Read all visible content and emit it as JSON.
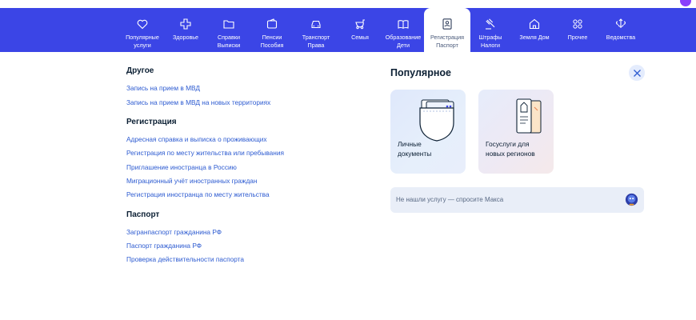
{
  "nav": [
    {
      "label": "Популярные\nуслуги",
      "icon": "heart-icon"
    },
    {
      "label": "Здоровье",
      "icon": "medical-cross-icon"
    },
    {
      "label": "Справки\nВыписки",
      "icon": "folder-icon"
    },
    {
      "label": "Пенсии\nПособия",
      "icon": "wallet-icon"
    },
    {
      "label": "Транспорт\nПрава",
      "icon": "car-icon"
    },
    {
      "label": "Семья",
      "icon": "stroller-icon"
    },
    {
      "label": "Образование\nДети",
      "icon": "book-icon"
    },
    {
      "label": "Регистрация\nПаспорт",
      "icon": "passport-icon",
      "active": true
    },
    {
      "label": "Штрафы\nНалоги",
      "icon": "gavel-icon"
    },
    {
      "label": "Земля Дом",
      "icon": "house-icon"
    },
    {
      "label": "Прочее",
      "icon": "grid-icon"
    },
    {
      "label": "Ведомства",
      "icon": "emblem-icon"
    }
  ],
  "sections": [
    {
      "title": "Другое",
      "links": [
        "Запись на прием в МВД",
        "Запись на прием в МВД на новых территориях"
      ]
    },
    {
      "title": "Регистрация",
      "links": [
        "Адресная справка и выписка о проживающих",
        "Регистрация по месту жительства или пребывания",
        "Приглашение иностранца в Россию",
        "Миграционный учёт иностранных граждан",
        "Регистрация иностранца по месту жительства"
      ]
    },
    {
      "title": "Паспорт",
      "links": [
        "Загранпаспорт гражданина РФ",
        "Паспорт гражданина РФ",
        "Проверка действительности паспорта"
      ]
    }
  ],
  "popular": {
    "title": "Популярное",
    "cards": [
      {
        "label": "Личные\nдокументы",
        "icon": "document-pocket-icon"
      },
      {
        "label": "Госуслуги для\nновых регионов",
        "icon": "passport-book-icon"
      }
    ]
  },
  "ask": {
    "text": "Не нашли услугу — спросите Макса",
    "icon": "robot-max-icon"
  },
  "colors": {
    "nav_bg": "#3b45e6",
    "link": "#2d5bd1",
    "card_bg": "#e8eefb",
    "ask_bg": "#e9eef8"
  }
}
